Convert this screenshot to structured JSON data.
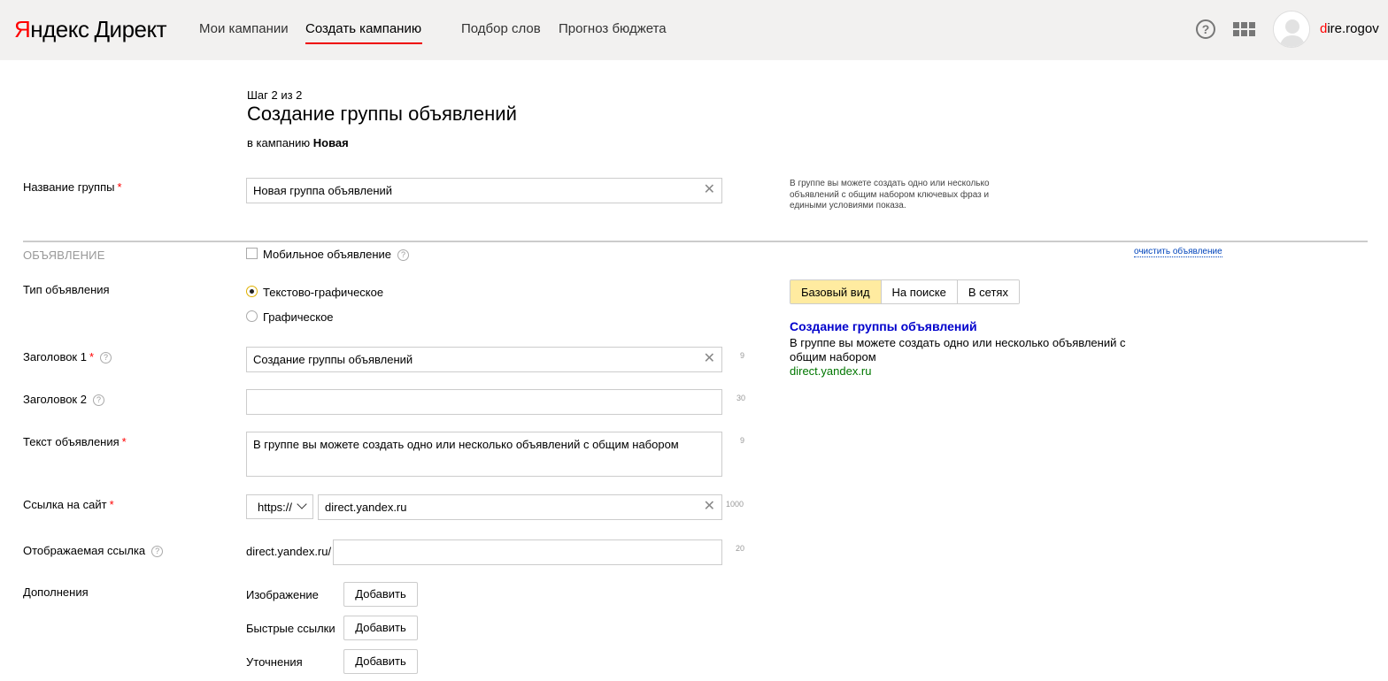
{
  "header": {
    "logo_first": "Я",
    "logo_rest": "ндекс",
    "logo_product": "Директ",
    "nav": [
      {
        "label": "Мои кампании"
      },
      {
        "label": "Создать кампанию",
        "active": true
      },
      {
        "label": "Подбор слов"
      },
      {
        "label": "Прогноз бюджета"
      }
    ],
    "help_symbol": "?",
    "username_first": "d",
    "username_rest": "ire.rogov",
    "accent_color": "#ff0000"
  },
  "page": {
    "step": "Шаг 2 из 2",
    "title": "Создание группы объявлений",
    "campaign_prefix": "в кампанию",
    "campaign_name": "Новая"
  },
  "group": {
    "label": "Название группы",
    "value": "Новая группа объявлений",
    "hint": "В группе вы можете создать одно или несколько объявлений с общим набором ключевых фраз и едиными условиями показа."
  },
  "ad": {
    "section_title": "ОБЪЯВЛЕНИЕ",
    "mobile_label": "Мобильное объявление",
    "mobile_checked": false,
    "clear_link": "очистить объявление",
    "type_label": "Тип объявления",
    "type_options": [
      {
        "label": "Текстово-графическое",
        "checked": true
      },
      {
        "label": "Графическое",
        "checked": false
      }
    ],
    "title1": {
      "label": "Заголовок 1",
      "value": "Создание группы объявлений",
      "counter": "9"
    },
    "title2": {
      "label": "Заголовок 2",
      "value": "",
      "counter": "30"
    },
    "text": {
      "label": "Текст объявления",
      "value": "В группе вы можете создать одно или несколько объявлений с общим набором",
      "counter": "9"
    },
    "link": {
      "label": "Ссылка на сайт",
      "protocol": "https://",
      "value": "direct.yandex.ru",
      "counter": "1000"
    },
    "display_link": {
      "label": "Отображаемая ссылка",
      "prefix": "direct.yandex.ru/",
      "value": "",
      "counter": "20"
    },
    "extensions": {
      "label": "Дополнения",
      "items": [
        {
          "label": "Изображение",
          "button": "Добавить"
        },
        {
          "label": "Быстрые ссылки",
          "button": "Добавить"
        },
        {
          "label": "Уточнения",
          "button": "Добавить"
        }
      ]
    }
  },
  "preview": {
    "tabs": [
      {
        "label": "Базовый вид",
        "active": true
      },
      {
        "label": "На поиске"
      },
      {
        "label": "В сетях"
      }
    ],
    "title": "Создание группы объявлений",
    "text": "В группе вы можете создать одно или несколько объявлений с общим набором",
    "url": "direct.yandex.ru",
    "title_color": "#0000cc",
    "url_color": "#007700"
  }
}
